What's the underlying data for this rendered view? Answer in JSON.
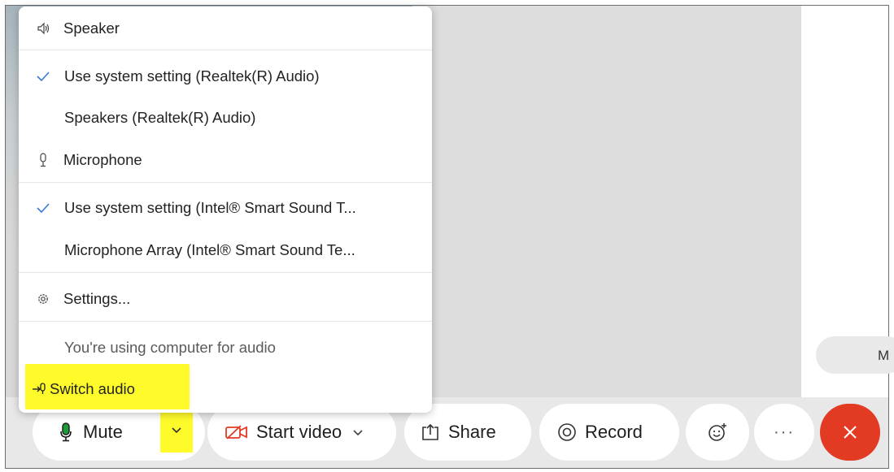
{
  "audio_menu": {
    "speaker_header": "Speaker",
    "speaker_options": [
      {
        "label": "Use system setting (Realtek(R) Audio)",
        "checked": true
      },
      {
        "label": "Speakers (Realtek(R) Audio)",
        "checked": false
      }
    ],
    "microphone_header": "Microphone",
    "microphone_options": [
      {
        "label": "Use system setting (Intel® Smart Sound T...",
        "checked": true
      },
      {
        "label": "Microphone Array (Intel® Smart Sound Te...",
        "checked": false
      }
    ],
    "settings_label": "Settings...",
    "status_text": "You're using computer for audio",
    "switch_audio_label": "Switch audio"
  },
  "controls": {
    "mute_label": "Mute",
    "start_video_label": "Start video",
    "share_label": "Share",
    "record_label": "Record",
    "more_label": "···"
  },
  "right_panel": {
    "pill_partial_text": "M"
  },
  "colors": {
    "leave_button": "#e23a23",
    "highlight": "#fffb2b",
    "check_accent": "#3a7bd5",
    "mic_active": "#1e9a3b",
    "video_off": "#e23a23"
  },
  "icons": {
    "speaker": "speaker-icon",
    "microphone": "microphone-icon",
    "check": "check-icon",
    "settings": "gear-icon",
    "switch_audio": "switch-audio-icon",
    "video": "video-off-icon",
    "share": "share-icon",
    "record": "record-icon",
    "reaction": "smiley-icon",
    "more": "more-icon",
    "leave": "close-icon",
    "caret": "chevron-down-icon"
  }
}
